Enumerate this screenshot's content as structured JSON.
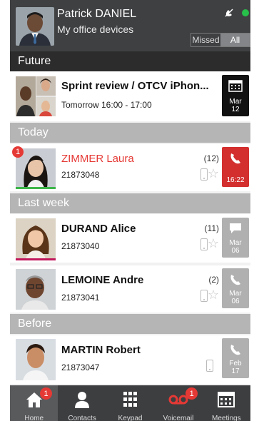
{
  "header": {
    "user_name": "Patrick DANIEL",
    "subtitle": "My office devices",
    "filter": {
      "missed": "Missed",
      "all": "All",
      "active": "All"
    },
    "status_color": "#27c04a",
    "icons": [
      "no-video-icon",
      "presence-dot"
    ]
  },
  "sections": {
    "future": "Future",
    "today": "Today",
    "last_week": "Last week",
    "before": "Before"
  },
  "rows": [
    {
      "title": "Sprint review / OTCV iPhon...",
      "subtitle": "Tomorrow 16:00 - 17:00",
      "tile_month": "Mar",
      "tile_day": "12",
      "tile_icon": "calendar-icon"
    },
    {
      "title": "ZIMMER Laura",
      "number": "21873048",
      "count": "(12)",
      "badge": "1",
      "tile_text": "16:22",
      "tile_icon": "phone-missed-icon",
      "presence_color": "#3db54a"
    },
    {
      "title": "DURAND Alice",
      "number": "21873040",
      "count": "(11)",
      "tile_month": "Mar",
      "tile_day": "06",
      "tile_icon": "message-icon",
      "presence_color": "#c2185b"
    },
    {
      "title": "LEMOINE Andre",
      "number": "21873041",
      "count": "(2)",
      "tile_month": "Mar",
      "tile_day": "06",
      "tile_icon": "phone-icon"
    },
    {
      "title": "MARTIN Robert",
      "number": "21873047",
      "tile_month": "Feb",
      "tile_day": "17",
      "tile_icon": "phone-icon"
    }
  ],
  "nav": [
    {
      "label": "Home",
      "icon": "home-icon",
      "badge": "1",
      "active": true
    },
    {
      "label": "Contacts",
      "icon": "contacts-icon"
    },
    {
      "label": "Keypad",
      "icon": "keypad-icon"
    },
    {
      "label": "Voicemail",
      "icon": "voicemail-icon",
      "badge": "1"
    },
    {
      "label": "Meetings",
      "icon": "meetings-icon"
    }
  ],
  "colors": {
    "missed": "#e53935",
    "accent_red": "#d32f2f",
    "header_bg": "#3f4042"
  }
}
